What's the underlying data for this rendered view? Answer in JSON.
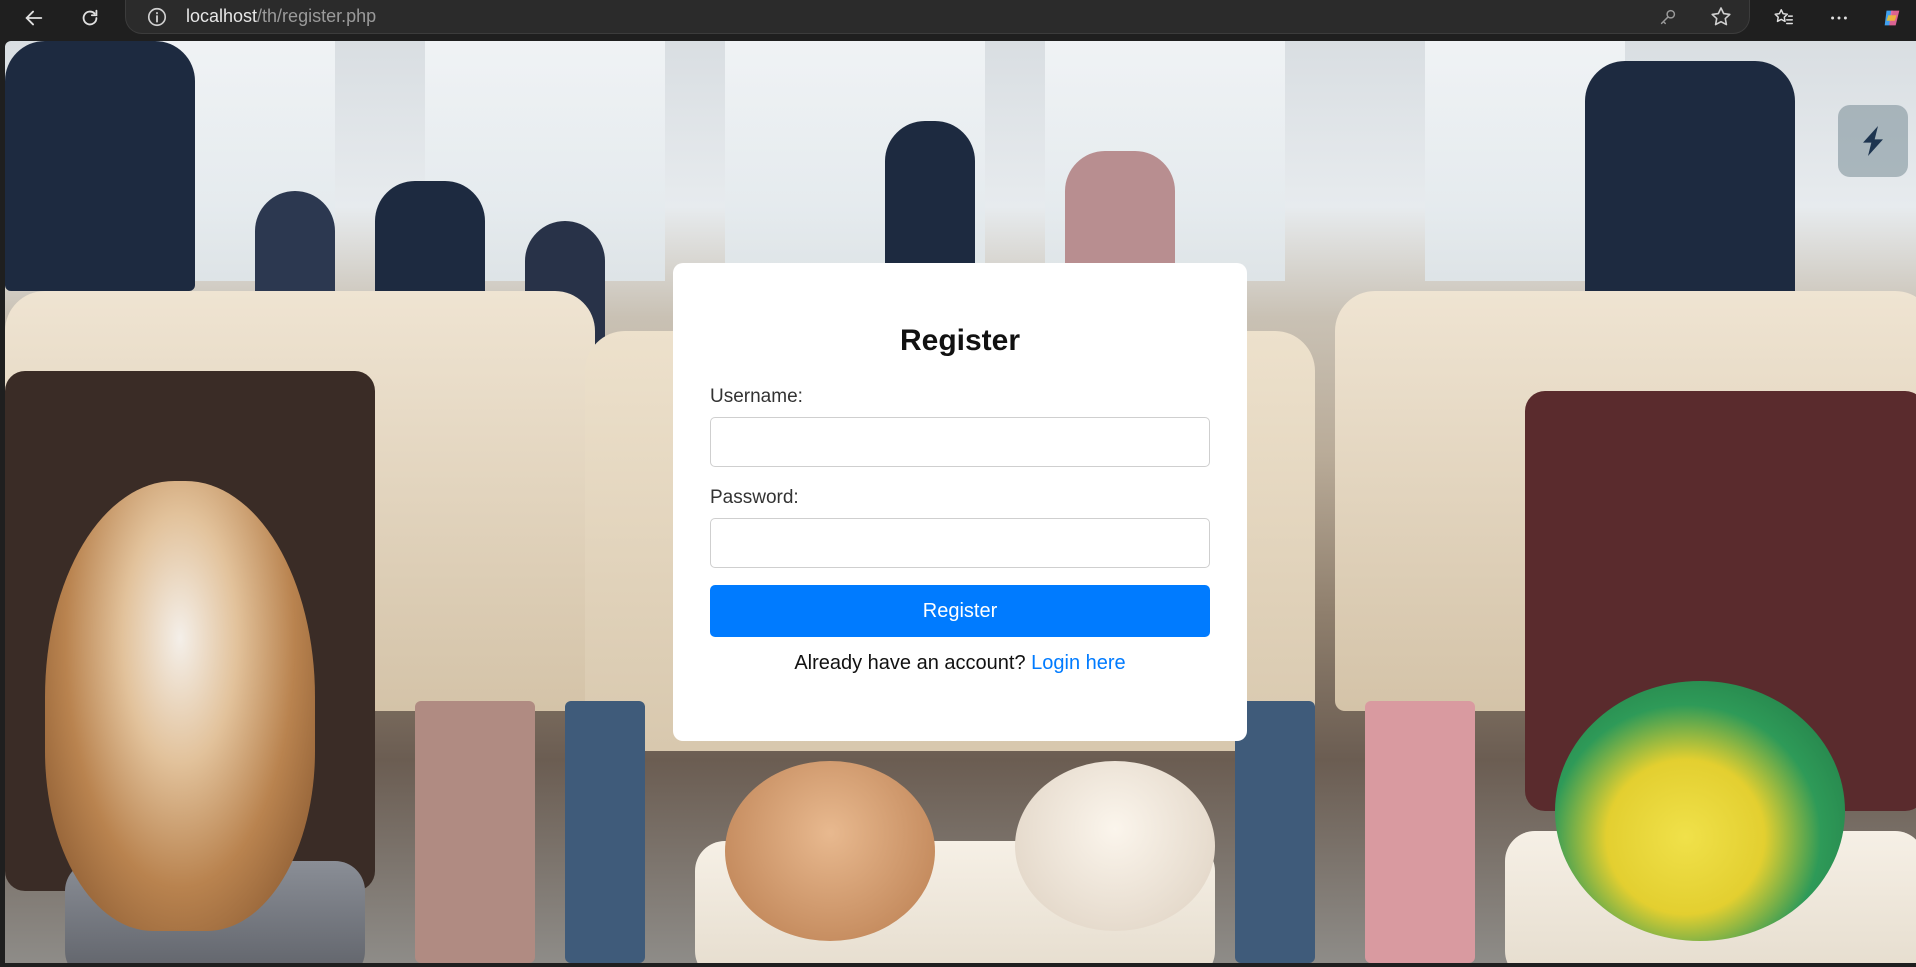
{
  "browser": {
    "url_host": "localhost",
    "url_path": "/th/register.php"
  },
  "form": {
    "title": "Register",
    "username_label": "Username:",
    "username_value": "",
    "password_label": "Password:",
    "password_value": "",
    "submit_label": "Register",
    "footer_text": "Already have an account?",
    "login_link": "Login here"
  },
  "colors": {
    "primary": "#007bff",
    "card_bg": "#ffffff"
  }
}
